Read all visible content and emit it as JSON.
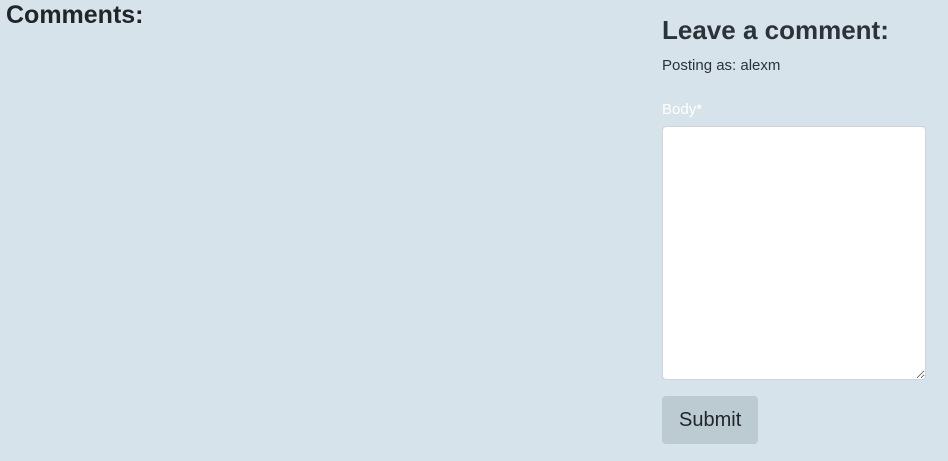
{
  "comments": {
    "title": "Comments:"
  },
  "comment_form": {
    "title": "Leave a comment:",
    "posting_as": "Posting as: alexm",
    "body_label": "Body*",
    "body_value": "",
    "submit_label": "Submit"
  },
  "colors": {
    "background": "#d6e3ea",
    "text": "#212529",
    "label": "#ffffff",
    "button_bg": "#bccbd2",
    "textarea_bg": "#ffffff"
  }
}
